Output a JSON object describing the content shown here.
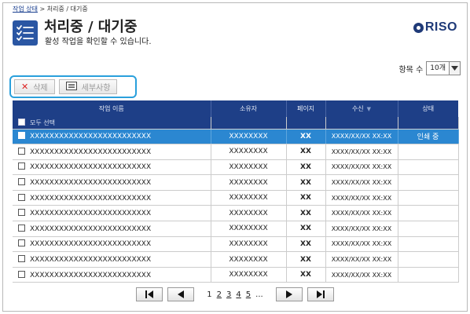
{
  "breadcrumb": {
    "root": "작업 상태",
    "sep1": " > ",
    "current": "처리중 / 대기중"
  },
  "header": {
    "title": "처리중 / 대기중",
    "subtitle": "활성 작업을 확인할 수 있습니다.",
    "logo": "RISO"
  },
  "item_count": {
    "label": "항목 수",
    "value": "10개"
  },
  "toolbar": {
    "delete_label": "삭제",
    "details_label": "세부사항"
  },
  "table": {
    "columns": [
      "작업 이름",
      "소유자",
      "페이지",
      "수신",
      "상태"
    ],
    "select_all_label": "모두 선택",
    "rows": [
      {
        "name": "XXXXXXXXXXXXXXXXXXXXXXXXX",
        "owner": "XXXXXXXX",
        "pages": "XX",
        "received": "XXXX/XX/XX XX:XX",
        "status": "인쇄 중"
      },
      {
        "name": "XXXXXXXXXXXXXXXXXXXXXXXXX",
        "owner": "XXXXXXXX",
        "pages": "XX",
        "received": "XXXX/XX/XX XX:XX",
        "status": ""
      },
      {
        "name": "XXXXXXXXXXXXXXXXXXXXXXXXX",
        "owner": "XXXXXXXX",
        "pages": "XX",
        "received": "XXXX/XX/XX XX:XX",
        "status": ""
      },
      {
        "name": "XXXXXXXXXXXXXXXXXXXXXXXXX",
        "owner": "XXXXXXXX",
        "pages": "XX",
        "received": "XXXX/XX/XX XX:XX",
        "status": ""
      },
      {
        "name": "XXXXXXXXXXXXXXXXXXXXXXXXX",
        "owner": "XXXXXXXX",
        "pages": "XX",
        "received": "XXXX/XX/XX XX:XX",
        "status": ""
      },
      {
        "name": "XXXXXXXXXXXXXXXXXXXXXXXXX",
        "owner": "XXXXXXXX",
        "pages": "XX",
        "received": "XXXX/XX/XX XX:XX",
        "status": ""
      },
      {
        "name": "XXXXXXXXXXXXXXXXXXXXXXXXX",
        "owner": "XXXXXXXX",
        "pages": "XX",
        "received": "XXXX/XX/XX XX:XX",
        "status": ""
      },
      {
        "name": "XXXXXXXXXXXXXXXXXXXXXXXXX",
        "owner": "XXXXXXXX",
        "pages": "XX",
        "received": "XXXX/XX/XX XX:XX",
        "status": ""
      },
      {
        "name": "XXXXXXXXXXXXXXXXXXXXXXXXX",
        "owner": "XXXXXXXX",
        "pages": "XX",
        "received": "XXXX/XX/XX XX:XX",
        "status": ""
      },
      {
        "name": "XXXXXXXXXXXXXXXXXXXXXXXXX",
        "owner": "XXXXXXXX",
        "pages": "XX",
        "received": "XXXX/XX/XX XX:XX",
        "status": ""
      }
    ]
  },
  "pagination": {
    "current": "1",
    "pages": [
      "2",
      "3",
      "4",
      "5"
    ],
    "more": "..."
  },
  "colors": {
    "header_bg": "#1e3f87",
    "selected_row": "#2b87d1",
    "toolbar_highlight": "#2aa0dc",
    "delete_icon": "#dd2222",
    "brand": "#1f3a78"
  },
  "icons": [
    "list-check-icon",
    "close-icon",
    "details-icon",
    "chevron-down-icon",
    "sort-down-icon",
    "first-page-icon",
    "prev-page-icon",
    "next-page-icon",
    "last-page-icon"
  ]
}
